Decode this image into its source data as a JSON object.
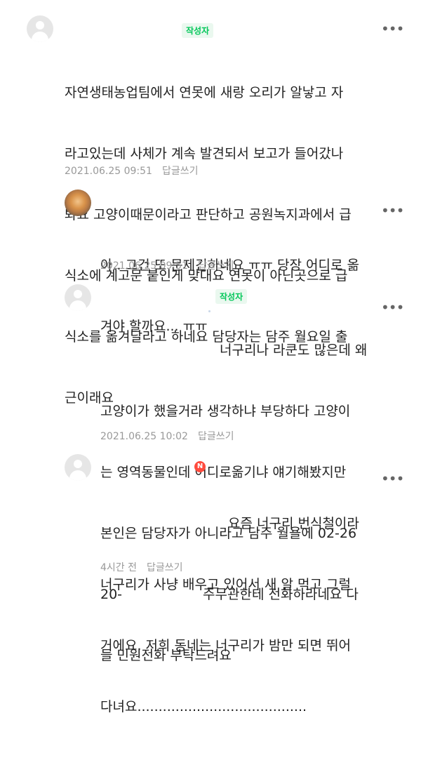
{
  "comments": [
    {
      "badge": "작성자",
      "more": "•••",
      "lines": [
        "자연생태농업팀에서 연못에 새랑 오리가 알낳고 자",
        "라고있는데 사체가 계속 발견되서 보고가 들어갔나",
        "봐요 고양이때문이라고 판단하고 공원녹지과에서 급",
        "식소에 계고문 붙인게 맞대요 연못이 아닌곳으로 급",
        "식소를 옮겨달라고 하네요 담당자는 담주 월요일 출",
        "근이래요"
      ],
      "date": "2021.06.25 09:51",
      "reply": "답글쓰기"
    },
    {
      "more": "•••",
      "lines": [
        "아.. 그건 또 문제긴하네요 ㅠㅠ 당장 어디로 옮",
        "겨야 할까요... ㅠㅠ"
      ],
      "date": "2021.06.25 09:51",
      "reply": "답글쓰기"
    },
    {
      "badge": "작성자",
      "more": "•••",
      "lines": [
        "너구리나 라쿤도 많은데 왜",
        "고양이가 했을거라 생각하냐 부당하다 고양이",
        "는 영역동물인데 어디로옮기냐 얘기해봤지만",
        "본인은 담당자가 아니라고 담주 월욜에 02-26",
        "20-",
        "주무관한테 전화하라네요 다",
        "들 민원전화 부탁드려요"
      ],
      "date": "2021.06.25 10:02",
      "reply": "답글쓰기"
    },
    {
      "badge_new": "N",
      "more": "•••",
      "lines": [
        "요즘 너구리 번식철이라",
        "너구리가 사냥 배우고 있어서 새 알 먹고 그럴",
        "거에요. 저희 동네는 너구리가 밤만 되면 뛰어",
        "다녀요........................................"
      ],
      "date": "4시간 전",
      "reply": "답글쓰기"
    }
  ],
  "colors": {
    "author_badge": "#03c75a",
    "new_badge": "#ff4a3d",
    "meta_text": "#999999"
  },
  "icons": [
    "avatar-default-icon",
    "avatar-cat-photo",
    "more-dots-icon"
  ]
}
